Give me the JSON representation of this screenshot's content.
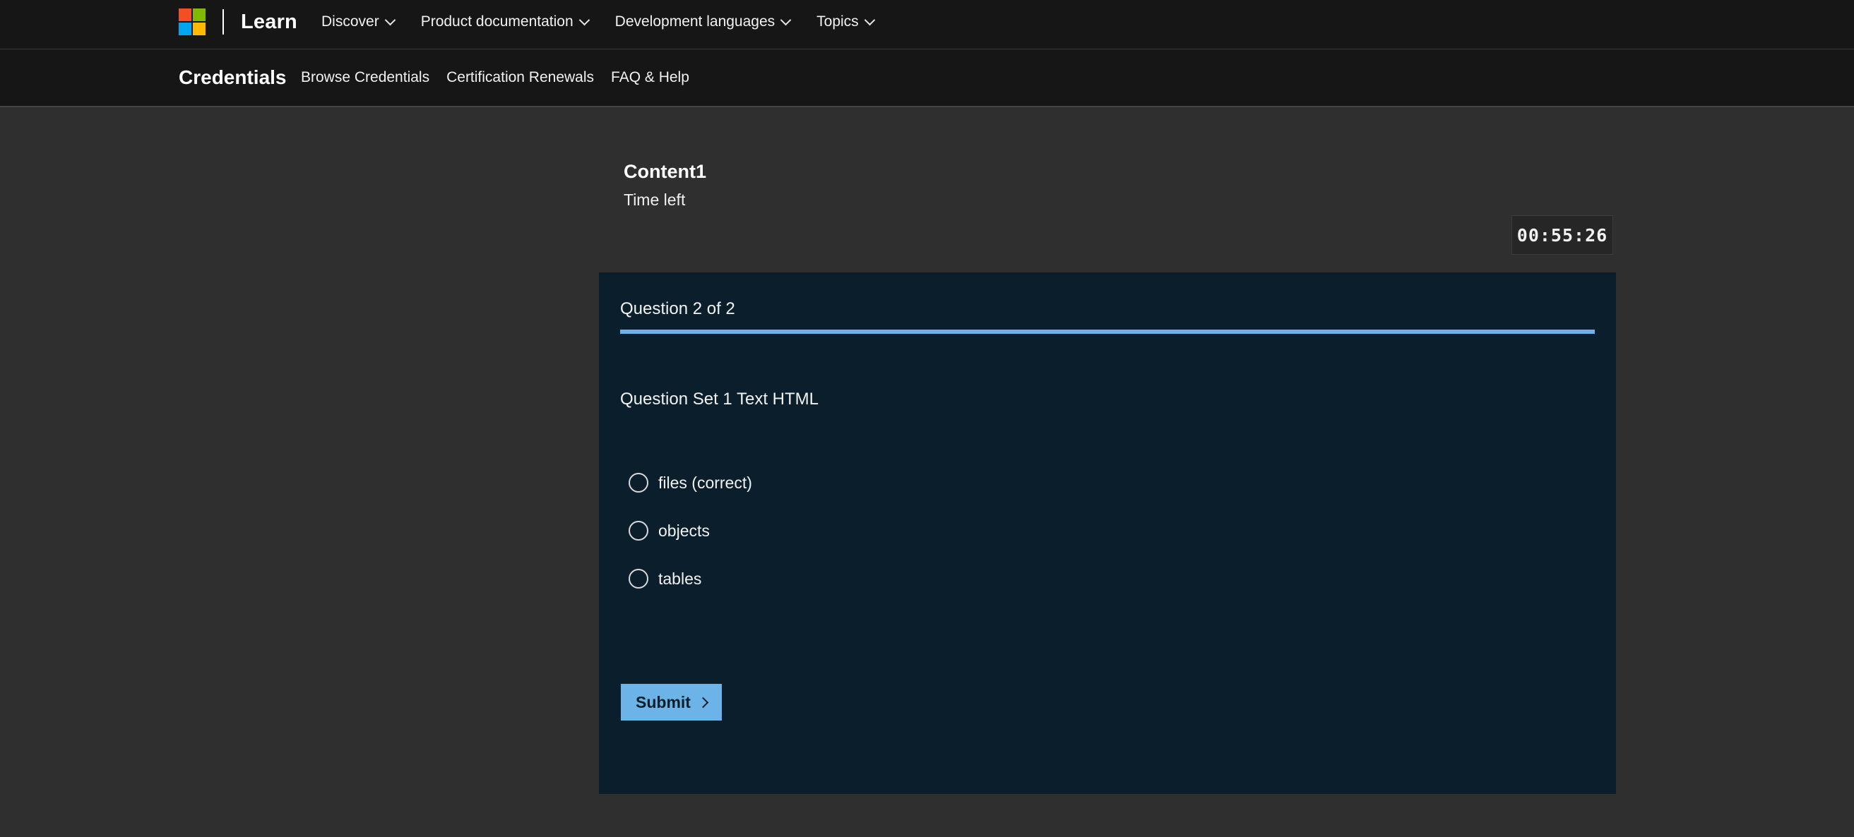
{
  "header": {
    "logo_icon": "microsoft-logo-icon",
    "logo_colors": [
      "#f25022",
      "#7fba00",
      "#00a4ef",
      "#ffb900"
    ],
    "brand": "Learn",
    "nav": [
      {
        "label": "Discover"
      },
      {
        "label": "Product documentation"
      },
      {
        "label": "Development languages"
      },
      {
        "label": "Topics"
      }
    ]
  },
  "subheader": {
    "title": "Credentials",
    "nav": [
      {
        "label": "Browse Credentials"
      },
      {
        "label": "Certification Renewals"
      },
      {
        "label": "FAQ & Help"
      }
    ]
  },
  "assessment": {
    "title": "Content1",
    "time_left_label": "Time left",
    "timer": "00:55:26"
  },
  "question": {
    "counter": "Question 2 of 2",
    "progress": 1.0,
    "text": "Question Set 1 Text HTML",
    "options": [
      {
        "label": "files (correct)"
      },
      {
        "label": "objects"
      },
      {
        "label": "tables"
      }
    ],
    "submit_label": "Submit"
  },
  "colors": {
    "page_bg": "#2f2f2f",
    "header_bg": "#161616",
    "card_bg": "#0a1e2c",
    "accent": "#6cb4e8"
  }
}
